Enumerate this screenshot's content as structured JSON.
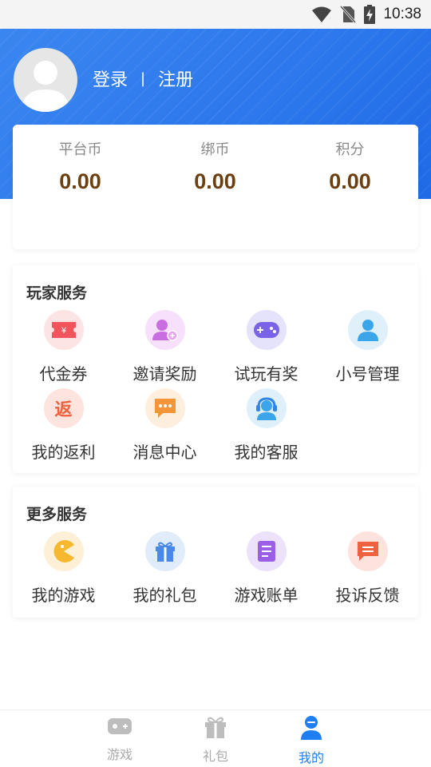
{
  "status_bar": {
    "time": "10:38"
  },
  "header": {
    "login": "登录",
    "separator": "|",
    "register": "注册"
  },
  "wallet": [
    {
      "label": "平台币",
      "value": "0.00"
    },
    {
      "label": "绑币",
      "value": "0.00"
    },
    {
      "label": "积分",
      "value": "0.00"
    }
  ],
  "player_services": {
    "title": "玩家服务",
    "items": [
      {
        "label": "代金券",
        "icon": "coupon-icon"
      },
      {
        "label": "邀请奖励",
        "icon": "invite-user-icon"
      },
      {
        "label": "试玩有奖",
        "icon": "gamepad-icon"
      },
      {
        "label": "小号管理",
        "icon": "user-icon"
      },
      {
        "label": "我的返利",
        "icon": "rebate-icon",
        "icon_text": "返"
      },
      {
        "label": "消息中心",
        "icon": "message-icon"
      },
      {
        "label": "我的客服",
        "icon": "headset-icon"
      }
    ]
  },
  "more_services": {
    "title": "更多服务",
    "items": [
      {
        "label": "我的游戏",
        "icon": "pacman-icon"
      },
      {
        "label": "我的礼包",
        "icon": "gift-icon"
      },
      {
        "label": "游戏账单",
        "icon": "bill-icon"
      },
      {
        "label": "投诉反馈",
        "icon": "feedback-icon"
      }
    ]
  },
  "tabbar": [
    {
      "label": "游戏",
      "icon": "gamepad-icon",
      "active": false
    },
    {
      "label": "礼包",
      "icon": "gift-icon",
      "active": false
    },
    {
      "label": "我的",
      "icon": "user-icon",
      "active": true
    }
  ],
  "colors": {
    "header": "#2c78ec",
    "accent": "#1f7ef2",
    "wallet_value": "#6b3f10"
  }
}
